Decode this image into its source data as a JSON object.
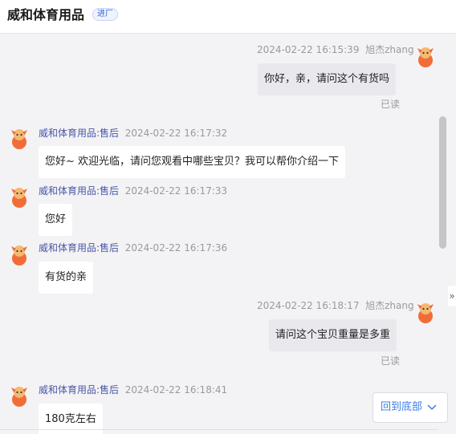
{
  "header": {
    "shop_name": "威和体育用品",
    "badge": "进厂"
  },
  "messages": [
    {
      "side": "right",
      "time": "2024-02-22 16:15:39",
      "sender": "旭杰zhang",
      "text": "你好，亲，请问这个有货吗",
      "read": "已读"
    },
    {
      "side": "left",
      "sender": "威和体育用品:售后",
      "time": "2024-02-22 16:17:32",
      "text": "您好~ 欢迎光临，请问您观看中哪些宝贝？我可以帮你介绍一下"
    },
    {
      "side": "left",
      "sender": "威和体育用品:售后",
      "time": "2024-02-22 16:17:33",
      "text": "您好"
    },
    {
      "side": "left",
      "sender": "威和体育用品:售后",
      "time": "2024-02-22 16:17:36",
      "text": "有货的亲"
    },
    {
      "side": "right",
      "time": "2024-02-22 16:18:17",
      "sender": "旭杰zhang",
      "text": "请问这个宝贝重量是多重",
      "read": "已读"
    },
    {
      "side": "left",
      "sender": "威和体育用品:售后",
      "time": "2024-02-22 16:18:41",
      "text": "180克左右"
    }
  ],
  "scroll_to_bottom_label": "回到底部",
  "collapse_glyph": "»",
  "colors": {
    "sender": "#4a57a8",
    "link": "#3b7ee8",
    "bubble_mine": "#e9e9ed",
    "avatar": "#f06d3a"
  }
}
